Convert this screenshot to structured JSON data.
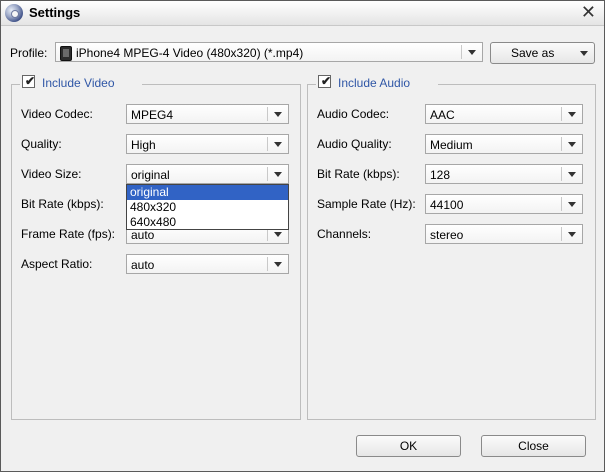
{
  "window": {
    "title": "Settings"
  },
  "profile": {
    "label": "Profile:",
    "value": "iPhone4 MPEG-4 Video (480x320) (*.mp4)",
    "save_as": "Save as"
  },
  "video": {
    "legend": "Include Video",
    "checked": true,
    "fields": [
      {
        "label": "Video Codec:",
        "value": "MPEG4"
      },
      {
        "label": "Quality:",
        "value": "High"
      },
      {
        "label": "Video Size:",
        "value": "original"
      },
      {
        "label": "Bit Rate (kbps):",
        "value": ""
      },
      {
        "label": "Frame Rate (fps):",
        "value": "auto"
      },
      {
        "label": "Aspect Ratio:",
        "value": "auto"
      }
    ],
    "size_options": [
      "original",
      "480x320",
      "640x480"
    ],
    "size_selected": "original"
  },
  "audio": {
    "legend": "Include Audio",
    "checked": true,
    "fields": [
      {
        "label": "Audio Codec:",
        "value": "AAC"
      },
      {
        "label": "Audio Quality:",
        "value": "Medium"
      },
      {
        "label": "Bit Rate (kbps):",
        "value": "128"
      },
      {
        "label": "Sample Rate (Hz):",
        "value": "44100"
      },
      {
        "label": "Channels:",
        "value": "stereo"
      }
    ]
  },
  "buttons": {
    "ok": "OK",
    "close": "Close"
  },
  "icons": {
    "window_close": "close-icon",
    "app": "app-disc-icon",
    "profile": "phone-icon"
  }
}
